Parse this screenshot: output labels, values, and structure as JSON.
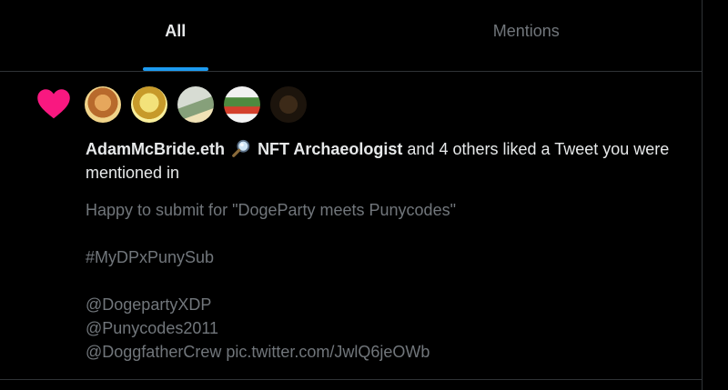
{
  "tabs": {
    "all_label": "All",
    "mentions_label": "Mentions"
  },
  "notification": {
    "type_icon": "heart-icon",
    "user1_name": "AdamMcBride.eth",
    "user1_emoji_icon": "magnifying-glass-icon",
    "user2_name": "NFT Archaeologist",
    "summary_suffix": " and 4 others liked a Tweet you were mentioned in",
    "tweet": {
      "line1": "Happy to submit for \"DogeParty meets Punycodes\"",
      "line2": "#MyDPxPunySub",
      "line3": "@DogepartyXDP",
      "line4": "@Punycodes2011",
      "line5": "@DoggfatherCrew pic.twitter.com/JwlQ6jeOWb"
    }
  },
  "colors": {
    "background": "#000000",
    "accent": "#1d9bf0",
    "like_pink": "#f91880",
    "primary_text": "#e7e9ea",
    "secondary_text": "#71767b",
    "divider": "#2f3336"
  }
}
